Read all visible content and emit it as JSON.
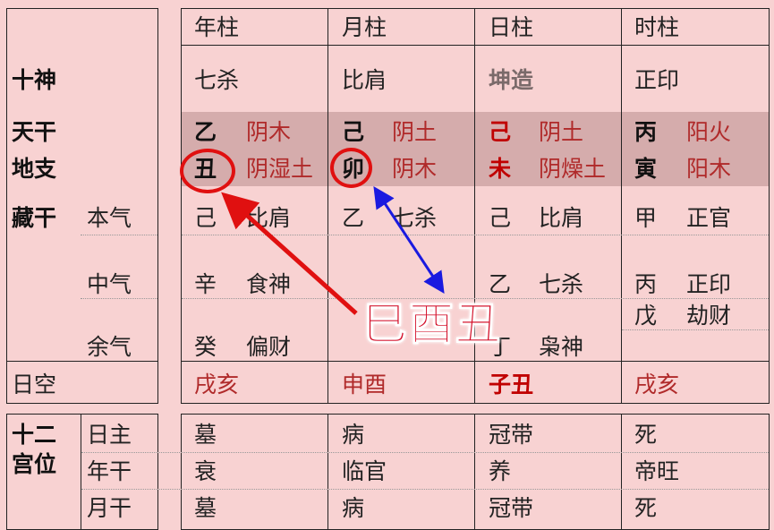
{
  "row_labels": {
    "shishen": "十神",
    "tiangan": "天干",
    "dizhi": "地支",
    "canggan": "藏干",
    "benqi": "本气",
    "zhongqi": "中气",
    "yuqi": "余气",
    "rikong": "日空",
    "shier1": "十二",
    "shier2": "宫位",
    "rizhu": "日主",
    "niangan": "年干",
    "yuegan": "月干"
  },
  "columns": [
    {
      "header": "年柱",
      "shishen": "七杀",
      "gan": "乙",
      "gan_el": "阴木",
      "zhi": "丑",
      "zhi_el": "阴湿土",
      "benqi": [
        "己",
        "比肩"
      ],
      "zhongqi": [
        "辛",
        "食神"
      ],
      "yuqi": [
        "癸",
        "偏财"
      ],
      "rikong": "戌亥",
      "gong": [
        "墓",
        "衰",
        "墓"
      ]
    },
    {
      "header": "月柱",
      "shishen": "比肩",
      "gan": "己",
      "gan_el": "阴土",
      "zhi": "卯",
      "zhi_el": "阴木",
      "benqi": [
        "乙",
        "七杀"
      ],
      "gong": [
        "病",
        "临官",
        "病"
      ]
    },
    {
      "header": "日柱",
      "shishen": "坤造",
      "gan": "己",
      "gan_el": "阴土",
      "zhi": "未",
      "zhi_el": "阴燥土",
      "benqi": [
        "己",
        "比肩"
      ],
      "zhongqi": [
        "乙",
        "七杀"
      ],
      "yuqi": [
        "丁",
        "枭神"
      ],
      "rikong": "子丑",
      "gong": [
        "冠带",
        "养",
        "冠带"
      ]
    },
    {
      "header": "时柱",
      "shishen": "正印",
      "gan": "丙",
      "gan_el": "阳火",
      "zhi": "寅",
      "zhi_el": "阳木",
      "benqi": [
        "甲",
        "正官"
      ],
      "zhongqi": [
        "丙",
        "正印"
      ],
      "zhongqi2": [
        "戊",
        "劫财"
      ],
      "rikong": "戌亥",
      "gong": [
        "死",
        "帝旺",
        "死"
      ]
    }
  ],
  "month_rikong": "申酉",
  "annotation": {
    "text": "巳酉丑",
    "circle_color": "#e01010",
    "arrow_red": "#e01010",
    "arrow_blue": "#1a1ae0"
  },
  "colors": {
    "background": "#f8d2d2",
    "band": "#d5acac",
    "element_text": "#b02a2a"
  }
}
